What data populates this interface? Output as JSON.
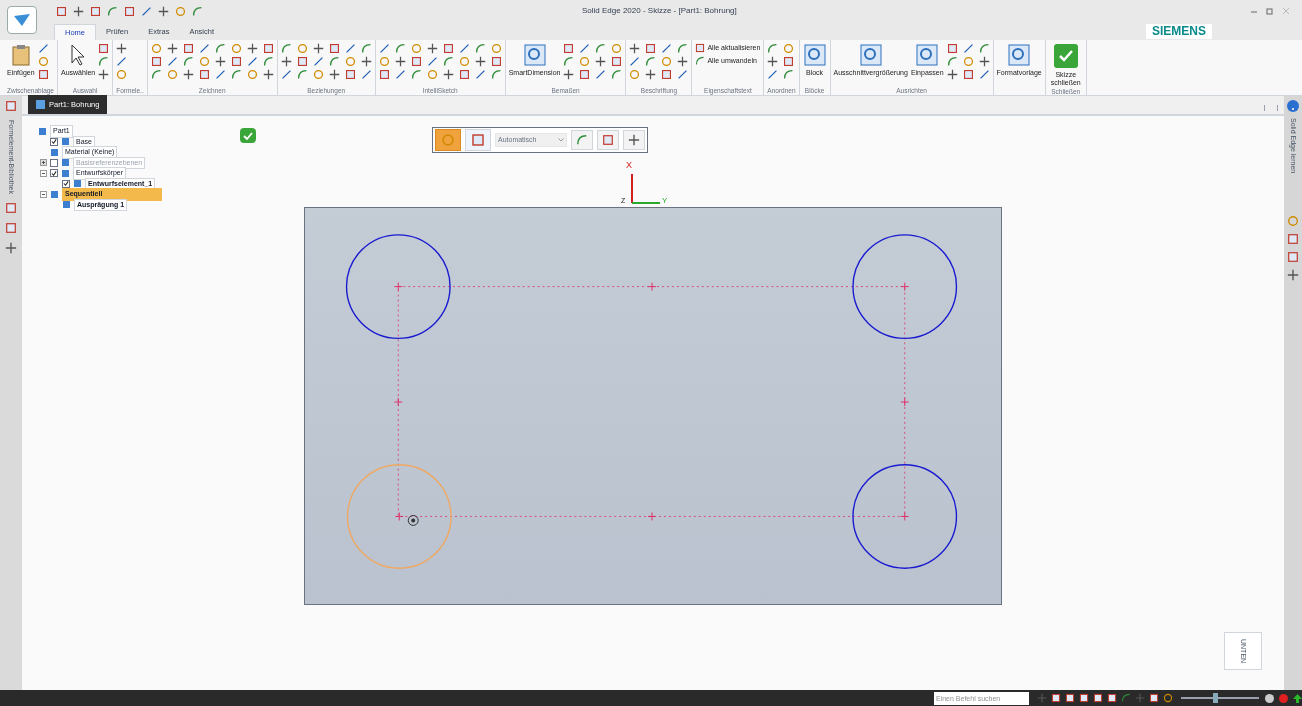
{
  "window": {
    "title": "Solid Edge 2020 - Skizze - [Part1: Bohrung]",
    "brand": "SIEMENS"
  },
  "tabs": [
    {
      "label": "Home",
      "selected": true
    },
    {
      "label": "Prüfen",
      "selected": false
    },
    {
      "label": "Extras",
      "selected": false
    },
    {
      "label": "Ansicht",
      "selected": false
    }
  ],
  "ribbon": [
    {
      "label": "Zwischenablage",
      "buttons": [
        "Einfügen"
      ]
    },
    {
      "label": "Auswahl",
      "buttons": [
        "Auswählen"
      ]
    },
    {
      "label": "Formele.."
    },
    {
      "label": "Zeichnen"
    },
    {
      "label": "Beziehungen"
    },
    {
      "label": "IntelliSketch"
    },
    {
      "label": "Bemaßen",
      "buttons": [
        "SmartDimension"
      ]
    },
    {
      "label": "Beschriftung"
    },
    {
      "label": "Eigenschaftstext",
      "buttons": [
        "Alle aktualisieren",
        "Alle umwandeln"
      ]
    },
    {
      "label": "Anordnen"
    },
    {
      "label": "Blöcke",
      "buttons": [
        "Block"
      ]
    },
    {
      "label": "Ausrichten",
      "buttons": [
        "Ausschnittvergrößerung",
        "Einpassen"
      ]
    },
    {
      "buttons": [
        "Formatvorlage"
      ]
    },
    {
      "label": "Schließen",
      "buttons": [
        "Skizze schließen"
      ]
    }
  ],
  "left_strip": {
    "label": "Formelement-Bibliothek"
  },
  "document_tab": {
    "label": "Part1: Bohrung"
  },
  "right_strip": {
    "label": "Solid Edge lernen"
  },
  "tree": [
    {
      "label": "Part1",
      "selected": false,
      "children": [
        {
          "label": "Base",
          "checked": true,
          "selected": false
        },
        {
          "label": "Material (Keine)",
          "selected": false
        },
        {
          "label": "Basisreferenzebenen",
          "checked": false,
          "expanded": false,
          "disabled": true,
          "selected": false
        },
        {
          "label": "Entwurfskörper",
          "checked": true,
          "expanded": true,
          "selected": false,
          "children": [
            {
              "label": "Entwurfselement_1",
              "checked": true,
              "selected": false
            }
          ]
        },
        {
          "label": "Sequentiell",
          "expanded": true,
          "selected": true,
          "children": [
            {
              "label": "Ausprägung 1",
              "selected": false
            }
          ]
        }
      ]
    }
  ],
  "sketch_toolbar": {
    "buttons": [
      {
        "selected": true
      },
      {
        "selected": false
      }
    ],
    "dropdown": "Automatisch"
  },
  "axes": {
    "x": "X",
    "y": "Y",
    "z": "Z"
  },
  "view_cube": {
    "label": "UNTEN"
  },
  "status_bar": {
    "search": {
      "placeholder": "Einen Befehl suchen"
    },
    "zoom": {
      "level": 0.42
    }
  }
}
